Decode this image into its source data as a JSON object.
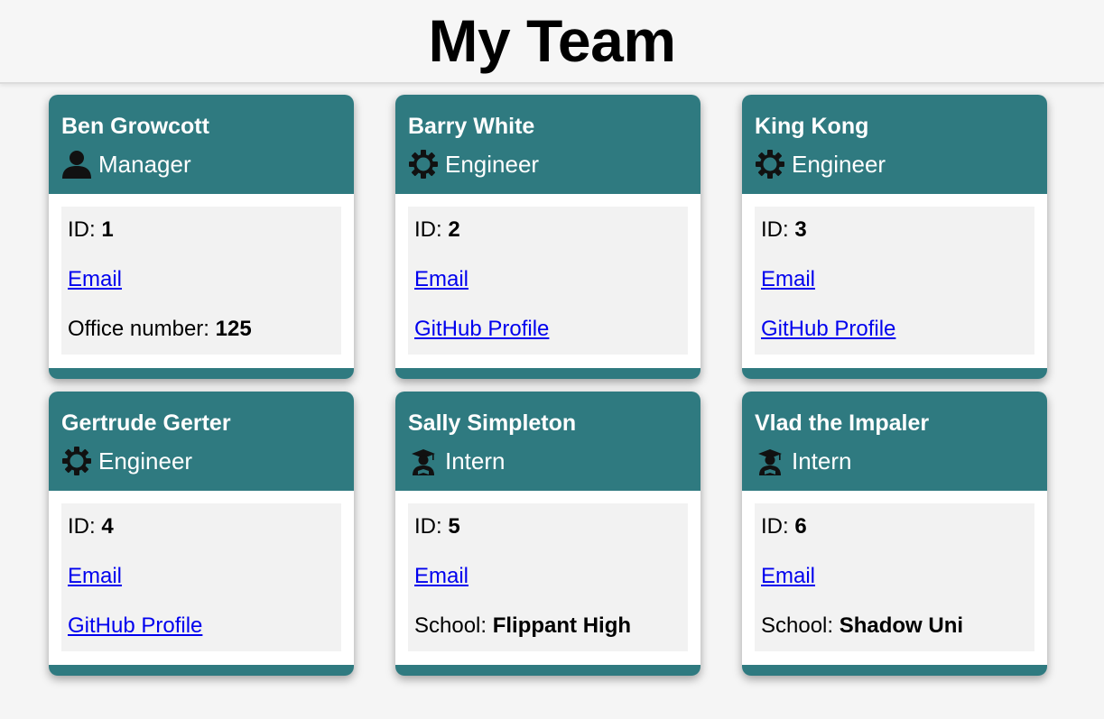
{
  "page": {
    "title": "My Team"
  },
  "colors": {
    "card_header": "#2f7a80",
    "link": "#0000ee"
  },
  "labels": {
    "id": "ID: ",
    "email": "Email",
    "office": "Office number: ",
    "github": "GitHub Profile",
    "school": "School: "
  },
  "employees": [
    {
      "name": "Ben Growcott",
      "role": "Manager",
      "icon": "person-icon",
      "id": "1",
      "extra_type": "office",
      "extra_value": "125"
    },
    {
      "name": "Barry White",
      "role": "Engineer",
      "icon": "gear-icon",
      "id": "2",
      "extra_type": "github",
      "extra_value": ""
    },
    {
      "name": "King Kong",
      "role": "Engineer",
      "icon": "gear-icon",
      "id": "3",
      "extra_type": "github",
      "extra_value": ""
    },
    {
      "name": "Gertrude Gerter",
      "role": "Engineer",
      "icon": "gear-icon",
      "id": "4",
      "extra_type": "github",
      "extra_value": ""
    },
    {
      "name": "Sally Simpleton",
      "role": "Intern",
      "icon": "graduate-icon",
      "id": "5",
      "extra_type": "school",
      "extra_value": "Flippant High"
    },
    {
      "name": "Vlad the Impaler",
      "role": "Intern",
      "icon": "graduate-icon",
      "id": "6",
      "extra_type": "school",
      "extra_value": "Shadow Uni"
    }
  ]
}
